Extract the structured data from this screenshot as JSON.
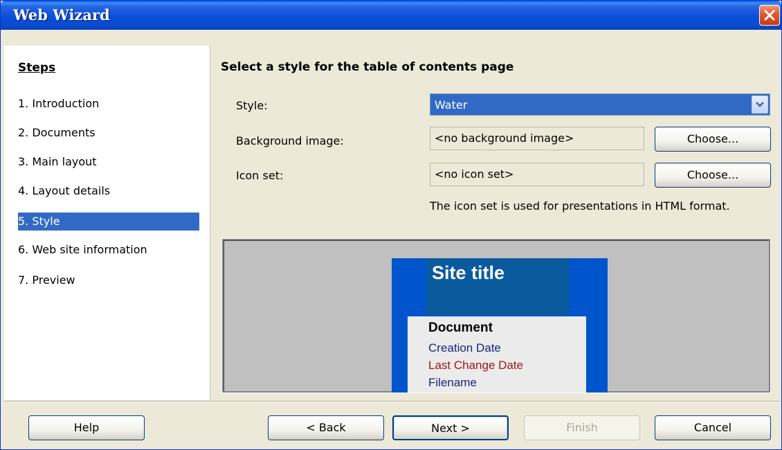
{
  "window": {
    "title": "Web Wizard"
  },
  "steps": {
    "heading": "Steps",
    "items": [
      {
        "label": "1.  Introduction"
      },
      {
        "label": "2.  Documents"
      },
      {
        "label": "3.  Main layout"
      },
      {
        "label": "4.  Layout details"
      },
      {
        "label": "5.  Style",
        "active": true
      },
      {
        "label": "6.  Web site information"
      },
      {
        "label": "7.  Preview"
      }
    ]
  },
  "page": {
    "heading": "Select a style for the table of contents page",
    "style_label": "Style:",
    "style_value": "Water",
    "background_label": "Background image:",
    "background_value": "<no background image>",
    "icon_label": "Icon set:",
    "icon_value": "<no icon set>",
    "choose_label": "Choose...",
    "icon_note": "The icon set is used for presentations in HTML format."
  },
  "preview": {
    "site_title": "Site title",
    "document": "Document",
    "creation_date": "Creation Date",
    "last_change_date": "Last Change Date",
    "filename": "Filename"
  },
  "buttons": {
    "help": "Help",
    "back": "< Back",
    "next": "Next >",
    "finish": "Finish",
    "cancel": "Cancel"
  },
  "colors": {
    "titlebar": "#0b4fd8",
    "selection": "#316ac5",
    "preview_frame": "#0055cc",
    "preview_header": "#0a5a9e",
    "creation_date": "#1a237e",
    "last_change_date": "#a01515"
  }
}
